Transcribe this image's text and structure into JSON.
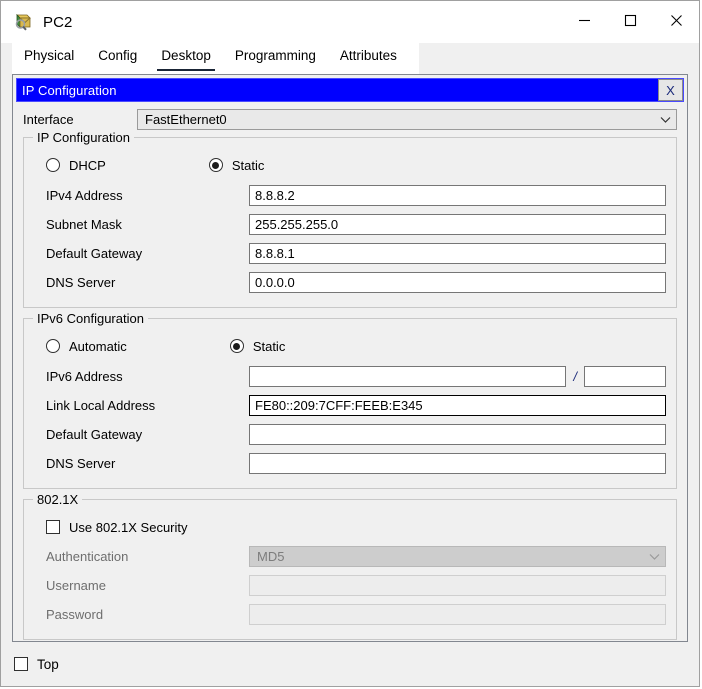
{
  "window": {
    "title": "PC2",
    "icon": "packet-tracer-device-icon",
    "controls": {
      "minimize": "minimize-icon",
      "maximize": "maximize-icon",
      "close": "close-icon"
    }
  },
  "tabs": [
    {
      "label": "Physical",
      "active": false
    },
    {
      "label": "Config",
      "active": false
    },
    {
      "label": "Desktop",
      "active": true
    },
    {
      "label": "Programming",
      "active": false
    },
    {
      "label": "Attributes",
      "active": false
    }
  ],
  "internal_window": {
    "title": "IP Configuration",
    "close_label": "X",
    "title_bg": "#0000ff",
    "title_fg": "#ffffff"
  },
  "interface": {
    "label": "Interface",
    "value": "FastEthernet0",
    "chevron": "chevron-down-icon"
  },
  "ipv4": {
    "legend": "IP Configuration",
    "mode": {
      "dhcp_label": "DHCP",
      "dhcp_selected": false,
      "static_label": "Static",
      "static_selected": true
    },
    "fields": [
      {
        "label": "IPv4 Address",
        "value": "8.8.8.2"
      },
      {
        "label": "Subnet Mask",
        "value": "255.255.255.0"
      },
      {
        "label": "Default Gateway",
        "value": "8.8.8.1"
      },
      {
        "label": "DNS Server",
        "value": "0.0.0.0"
      }
    ]
  },
  "ipv6": {
    "legend": "IPv6 Configuration",
    "mode": {
      "automatic_label": "Automatic",
      "automatic_selected": false,
      "static_label": "Static",
      "static_selected": true
    },
    "address": {
      "label": "IPv6 Address",
      "value": "",
      "separator": "/",
      "prefix_value": ""
    },
    "fields": [
      {
        "label": "Link Local Address",
        "value": "FE80::209:7CFF:FEEB:E345",
        "focused": true
      },
      {
        "label": "Default Gateway",
        "value": "",
        "focused": false
      },
      {
        "label": "DNS Server",
        "value": "",
        "focused": false
      }
    ]
  },
  "dot1x": {
    "legend": "802.1X",
    "use_security_label": "Use 802.1X Security",
    "use_security_checked": false,
    "authentication": {
      "label": "Authentication",
      "value": "MD5",
      "disabled": true,
      "chevron": "chevron-down-icon"
    },
    "username": {
      "label": "Username",
      "value": "",
      "disabled": true
    },
    "password": {
      "label": "Password",
      "value": "",
      "disabled": true
    }
  },
  "bottom": {
    "top_label": "Top",
    "top_checked": false
  }
}
